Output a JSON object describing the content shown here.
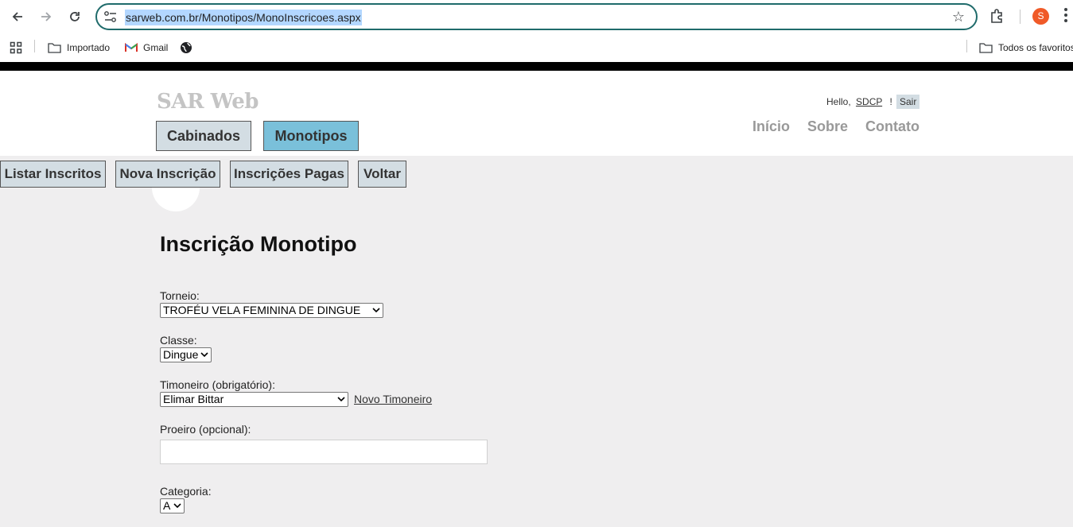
{
  "browser": {
    "url": "sarweb.com.br/Monotipos/MonoInscricoes.aspx",
    "avatar_letter": "S",
    "bookmarks": [
      {
        "label": "Importado",
        "icon": "folder-icon"
      },
      {
        "label": "Gmail",
        "icon": "gmail-icon"
      }
    ],
    "all_bookmarks_label": "Todos os favoritos"
  },
  "header": {
    "site_title": "SAR Web",
    "tabs": [
      {
        "label": "Cabinados",
        "active": false
      },
      {
        "label": "Monotipos",
        "active": true
      }
    ],
    "greeting": "Hello,",
    "username": "SDCP",
    "exclamation": "!",
    "logout_label": "Sair",
    "menu": [
      "Início",
      "Sobre",
      "Contato"
    ]
  },
  "subnav": [
    "Listar Inscritos",
    "Nova Inscrição",
    "Inscrições Pagas",
    "Voltar"
  ],
  "form": {
    "heading": "Inscrição Monotipo",
    "torneio_label": "Torneio:",
    "torneio_value": "TROFÉU VELA FEMININA DE DINGUE",
    "classe_label": "Classe:",
    "classe_value": "Dingue",
    "timoneiro_label": "Timoneiro (obrigatório):",
    "timoneiro_value": "Elimar Bittar",
    "novo_timoneiro_link": "Novo Timoneiro",
    "proeiro_label": "Proeiro (opcional):",
    "proeiro_value": "",
    "categoria_label": "Categoria:",
    "categoria_value": "A"
  },
  "colors": {
    "active_tab": "#7ac0da",
    "button": "#d3dde3",
    "content_bg": "#efeeef",
    "omnibox_border": "#1f6b6b",
    "avatar": "#f05a28"
  }
}
